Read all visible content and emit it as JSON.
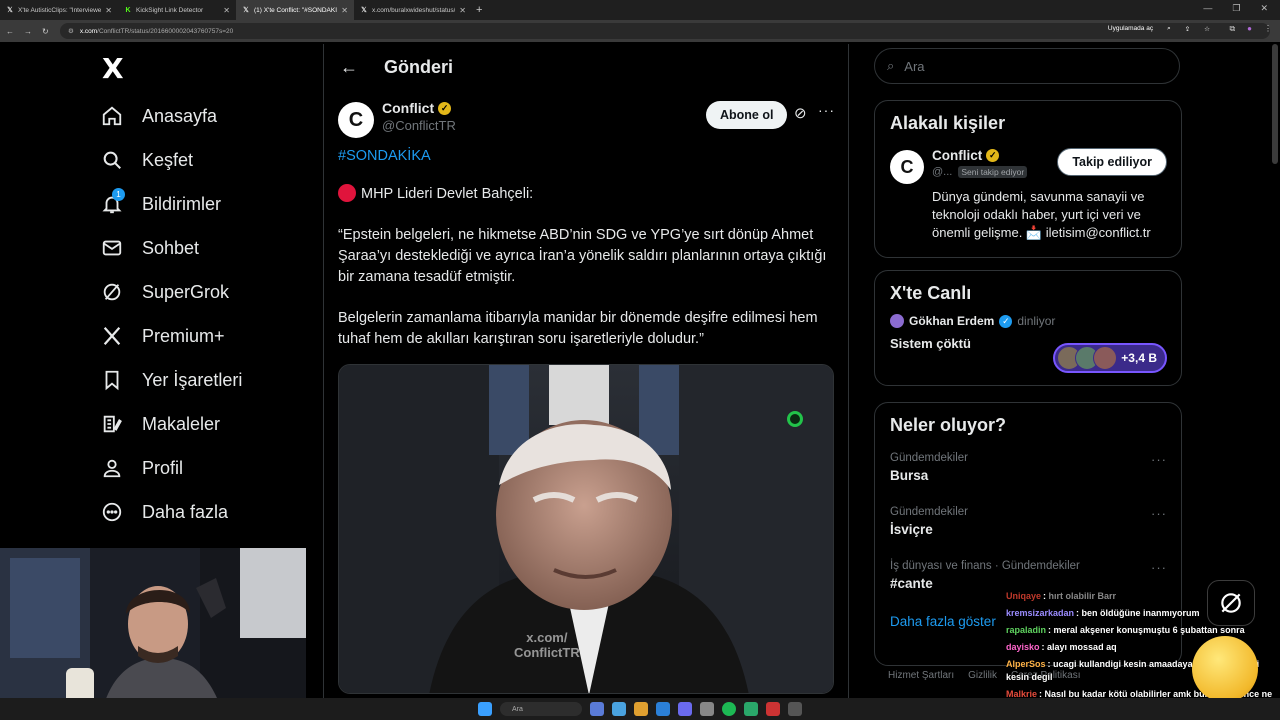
{
  "browser": {
    "tabs": [
      {
        "title": "X'te AutisticClips: \"Interviewer:",
        "icon": "x-favicon-icon",
        "active": false
      },
      {
        "title": "KickSight Link Detector",
        "icon": "kick-favicon-icon",
        "active": false
      },
      {
        "title": "(1) X'te Conflict: \"#SONDAKİKA",
        "icon": "x-favicon-icon",
        "active": true
      },
      {
        "title": "x.com/buralxwideshut/status/2(",
        "icon": "x-favicon-icon",
        "active": false
      }
    ],
    "url_domain": "x.com",
    "url_path": "/ConflictTR/status/2016600002043760757s=20",
    "open_in_app": "Uygulamada aç"
  },
  "nav": {
    "logo": "X",
    "items": [
      {
        "label": "Anasayfa",
        "icon": "home-icon"
      },
      {
        "label": "Keşfet",
        "icon": "search-icon"
      },
      {
        "label": "Bildirimler",
        "icon": "bell-icon",
        "badge": "1"
      },
      {
        "label": "Sohbet",
        "icon": "mail-icon"
      },
      {
        "label": "SuperGrok",
        "icon": "grok-icon"
      },
      {
        "label": "Premium+",
        "icon": "x-premium-icon"
      },
      {
        "label": "Yer İşaretleri",
        "icon": "bookmark-icon"
      },
      {
        "label": "Makaleler",
        "icon": "article-icon"
      },
      {
        "label": "Profil",
        "icon": "profile-icon"
      },
      {
        "label": "Daha fazla",
        "icon": "more-circle-icon"
      }
    ]
  },
  "main": {
    "title": "Gönderi",
    "post": {
      "author_name": "Conflict",
      "author_handle": "@ConflictTR",
      "follow_label": "Abone ol",
      "hashtag": "#SONDAKİKA",
      "line1": "MHP Lideri Devlet Bahçeli:",
      "para1": "“Epstein belgeleri, ne hikmetse ABD’nin SDG ve YPG’ye sırt dönüp Ahmet Şaraa’yı desteklediği ve ayrıca İran’a yönelik saldırı planlarının ortaya çıktığı bir zamana tesadüf etmiştir.",
      "para2": "Belgelerin zamanlama itibarıyla manidar bir dönemde deşifre edilmesi hem tuhaf hem de akılları karıştıran soru işaretleriyle doludur.”",
      "watermark_line1": "x.com/",
      "watermark_line2": "ConflictTR"
    }
  },
  "right": {
    "search_placeholder": "Ara",
    "related": {
      "title": "Alakalı kişiler",
      "name": "Conflict",
      "handle": "@...",
      "follows_you": "Seni takip ediyor",
      "button": "Takip ediliyor",
      "bio": "Dünya gündemi, savunma sanayii ve teknoloji odaklı haber, yurt içi veri ve önemli gelişme. 📩 iletisim@conflict.tr"
    },
    "live": {
      "title": "X'te Canlı",
      "host": "Gökhan Erdem",
      "host_status": "dinliyor",
      "topic": "Sistem çöktü",
      "listeners": "+3,4 B"
    },
    "trends": {
      "title": "Neler oluyor?",
      "items": [
        {
          "category": "Gündemdekiler",
          "topic": "Bursa"
        },
        {
          "category": "Gündemdekiler",
          "topic": "İsviçre"
        },
        {
          "category": "İş dünyası ve finans · Gündemdekiler",
          "topic": "#cante"
        }
      ],
      "show_more": "Daha fazla göster"
    },
    "footer": [
      "Hizmet Şartları",
      "Gizlilik",
      "Çerez Politikası"
    ]
  },
  "chat": [
    {
      "user": "Uniqaye",
      "msg": "hırt olabilir Barr",
      "color": "#c0392b"
    },
    {
      "user": "kremsizarkadan",
      "msg": "ben öldüğüne inanmıyorum",
      "color": "#9b8cff"
    },
    {
      "user": "rapaladin",
      "msg": "meral akşener konuşmuştu 6 şubattan sonra",
      "color": "#5fd35f"
    },
    {
      "user": "dayisko",
      "msg": "alayı mossad aq",
      "color": "#ff66cc"
    },
    {
      "user": "AlperSos",
      "msg": "ucagi kullandigi kesin amaadaya gidip gitmedigi kesin degil",
      "color": "#ffb347"
    },
    {
      "user": "Malkrie",
      "msg": "Nasıl bu kadar kötü olabilirler amk bunlar görünce ne kadar masumum diyorum",
      "color": "#e74c3c"
    }
  ],
  "taskbar": {
    "search_label": "Ara"
  }
}
